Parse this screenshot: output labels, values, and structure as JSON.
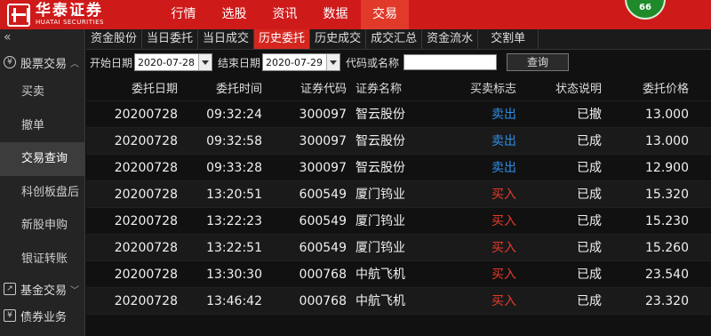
{
  "app": {
    "logo_cn": "华泰证券",
    "logo_en": "HUATAI SECURITIES",
    "badge": "66"
  },
  "topnav": [
    "行情",
    "选股",
    "资讯",
    "数据",
    "交易"
  ],
  "sidebar": {
    "collapse": "«",
    "group_trade": "股票交易",
    "items": [
      "买卖",
      "撤单",
      "交易查询",
      "科创板盘后",
      "新股申购",
      "银证转账"
    ],
    "group_fund": "基金交易",
    "group_bond": "债券业务"
  },
  "tabs": [
    "资金股份",
    "当日委托",
    "当日成交",
    "历史委托",
    "历史成交",
    "成交汇总",
    "资金流水",
    "交割单"
  ],
  "filters": {
    "start_label": "开始日期",
    "start_value": "2020-07-28",
    "end_label": "结束日期",
    "end_value": "2020-07-29",
    "code_label": "代码或名称",
    "code_value": "",
    "query_button": "查询"
  },
  "table": {
    "headers": [
      "委托日期",
      "委托时间",
      "证券代码",
      "证券名称",
      "买卖标志",
      "状态说明",
      "委托价格"
    ],
    "rows": [
      [
        "20200728",
        "09:32:24",
        "300097",
        "智云股份",
        "卖出",
        "已撤",
        "13.000"
      ],
      [
        "20200728",
        "09:32:58",
        "300097",
        "智云股份",
        "卖出",
        "已成",
        "13.000"
      ],
      [
        "20200728",
        "09:33:28",
        "300097",
        "智云股份",
        "卖出",
        "已成",
        "12.900"
      ],
      [
        "20200728",
        "13:20:51",
        "600549",
        "厦门钨业",
        "买入",
        "已成",
        "15.320"
      ],
      [
        "20200728",
        "13:22:23",
        "600549",
        "厦门钨业",
        "买入",
        "已成",
        "15.230"
      ],
      [
        "20200728",
        "13:22:51",
        "600549",
        "厦门钨业",
        "买入",
        "已成",
        "15.260"
      ],
      [
        "20200728",
        "13:30:30",
        "000768",
        "中航飞机",
        "买入",
        "已成",
        "23.540"
      ],
      [
        "20200728",
        "13:46:42",
        "000768",
        "中航飞机",
        "买入",
        "已成",
        "23.320"
      ]
    ]
  },
  "colors": {
    "brand_red": "#cf1a1a",
    "sell": "#2f8ee8",
    "buy": "#e83a2a"
  }
}
